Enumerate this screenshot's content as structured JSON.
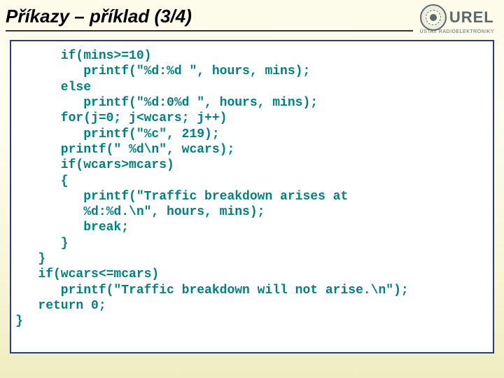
{
  "header": {
    "title": "Příkazy – příklad (3/4)",
    "logo_text": "UREL",
    "logo_sub": "ÚSTAV RADIOELEKTRONIKY"
  },
  "code": "      if(mins>=10)\n         printf(\"%d:%d \", hours, mins);\n      else\n         printf(\"%d:0%d \", hours, mins);\n      for(j=0; j<wcars; j++)\n         printf(\"%c\", 219);\n      printf(\" %d\\n\", wcars);\n      if(wcars>mcars)\n      {\n         printf(\"Traffic breakdown arises at\n         %d:%d.\\n\", hours, mins);\n         break;\n      }\n   }\n   if(wcars<=mcars)\n      printf(\"Traffic breakdown will not arise.\\n\");\n   return 0;\n}"
}
